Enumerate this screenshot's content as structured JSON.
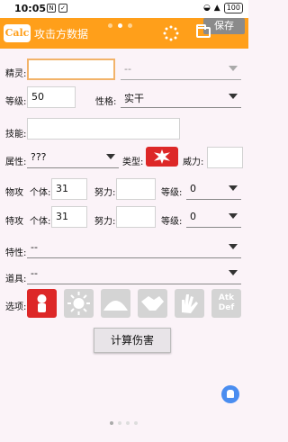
{
  "status_bar": {
    "time": "10:05",
    "icons": [
      "N",
      "✓"
    ],
    "battery": "100"
  },
  "app": {
    "logo": "Calc",
    "title": "攻击方数据",
    "save_label": "保存"
  },
  "form": {
    "spirit_label": "精灵:",
    "spirit_value": "",
    "spirit_form_value": "--",
    "level_label": "等级:",
    "level_value": "50",
    "nature_label": "性格:",
    "nature_value": "实干",
    "skill_label": "技能:",
    "skill_value": "",
    "attribute_label": "属性:",
    "attribute_value": "???",
    "type_label": "类型:",
    "power_label": "威力:",
    "power_value": "",
    "physical": {
      "label": "物攻",
      "iv_label": "个体:",
      "iv_value": "31",
      "ev_label": "努力:",
      "ev_value": "",
      "grade_label": "等级:",
      "grade_value": "0"
    },
    "special": {
      "label": "特攻",
      "iv_label": "个体:",
      "iv_value": "31",
      "ev_label": "努力:",
      "ev_value": "",
      "grade_label": "等级:",
      "grade_value": "0"
    },
    "trait_label": "特性:",
    "trait_value": "--",
    "item_label": "道具:",
    "item_value": "--",
    "options_label": "选项:",
    "options": [
      "crit-icon",
      "sun-icon",
      "dome-icon",
      "handshake-icon",
      "hands-icon",
      "atk-def-icon"
    ],
    "options_atk_def_text": "Atk Def",
    "calc_button": "计算伤害"
  },
  "colors": {
    "accent": "#ff9f1a",
    "type_red": "#dd2727",
    "save_grey": "#8a8a8a"
  }
}
